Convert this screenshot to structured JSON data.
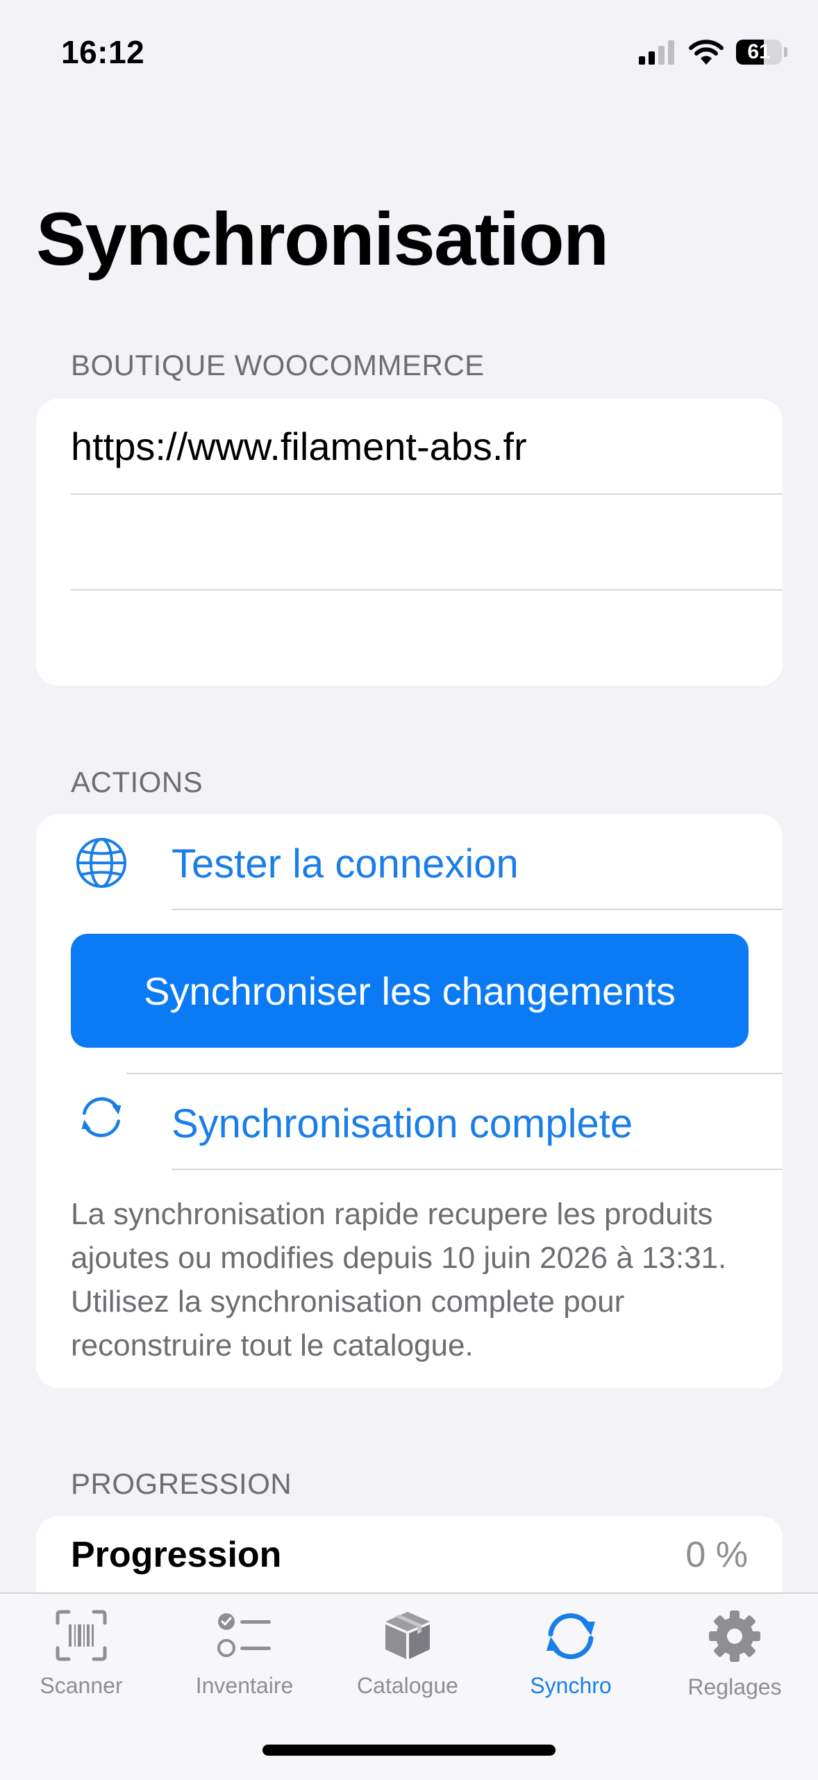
{
  "status_bar": {
    "time": "16:12",
    "battery_level": "61",
    "battery_fraction": 0.61
  },
  "page": {
    "title": "Synchronisation"
  },
  "store_section": {
    "header": "BOUTIQUE WOOCOMMERCE",
    "url_value": "https://www.filament-abs.fr",
    "field2_value": "",
    "field3_value": ""
  },
  "actions_section": {
    "header": "ACTIONS",
    "test_connection_label": "Tester la connexion",
    "test_connection_icon": "globe-icon",
    "sync_changes_label": "Synchroniser les changements",
    "full_sync_label": "Synchronisation complete",
    "full_sync_icon": "sync-arrows-icon",
    "footnote": "La synchronisation rapide recupere les produits ajoutes ou modifies depuis 10 juin 2026 à 13:31. Utilisez la synchronisation complete pour reconstruire tout le catalogue."
  },
  "progress_section": {
    "header": "PROGRESSION",
    "label": "Progression",
    "value": "0 %"
  },
  "tab_bar": {
    "accent_color": "#1A7EE8",
    "inactive_color": "#8E8E93",
    "tabs": [
      {
        "label": "Scanner",
        "icon": "barcode-scan-icon",
        "active": false
      },
      {
        "label": "Inventaire",
        "icon": "checklist-icon",
        "active": false
      },
      {
        "label": "Catalogue",
        "icon": "box-icon",
        "active": false
      },
      {
        "label": "Synchro",
        "icon": "sync-icon",
        "active": true
      },
      {
        "label": "Reglages",
        "icon": "gear-icon",
        "active": false
      }
    ]
  }
}
